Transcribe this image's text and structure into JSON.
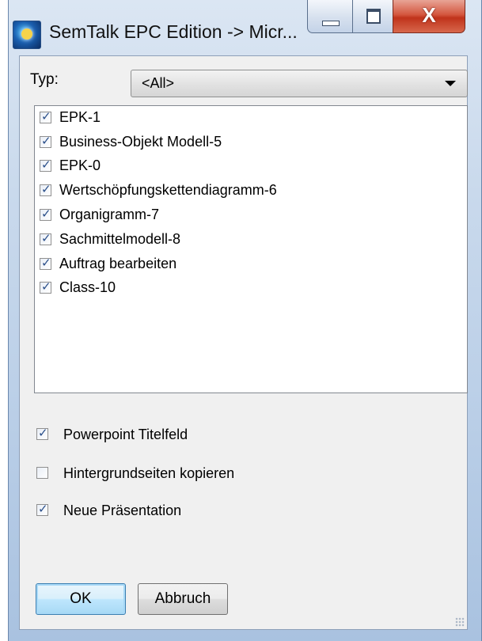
{
  "window": {
    "title": "SemTalk EPC Edition -> Micr...",
    "icon": "semtalk-app-icon",
    "controls": {
      "minimize": "minimize-icon",
      "maximize": "maximize-icon",
      "close": "X"
    }
  },
  "typ": {
    "label": "Typ:",
    "selected": "<All>"
  },
  "list": {
    "items": [
      {
        "label": "EPK-1",
        "checked": true
      },
      {
        "label": "Business-Objekt Modell-5",
        "checked": true
      },
      {
        "label": "EPK-0",
        "checked": true
      },
      {
        "label": "Wertschöpfungskettendiagramm-6",
        "checked": true
      },
      {
        "label": "Organigramm-7",
        "checked": true
      },
      {
        "label": "Sachmittelmodell-8",
        "checked": true
      },
      {
        "label": "Auftrag bearbeiten",
        "checked": true
      },
      {
        "label": "Class-10",
        "checked": true
      }
    ]
  },
  "options": [
    {
      "label": "Powerpoint Titelfeld",
      "checked": true
    },
    {
      "label": "Hintergrundseiten kopieren",
      "checked": false
    },
    {
      "label": "Neue Präsentation",
      "checked": true
    }
  ],
  "buttons": {
    "ok": "OK",
    "cancel": "Abbruch"
  }
}
